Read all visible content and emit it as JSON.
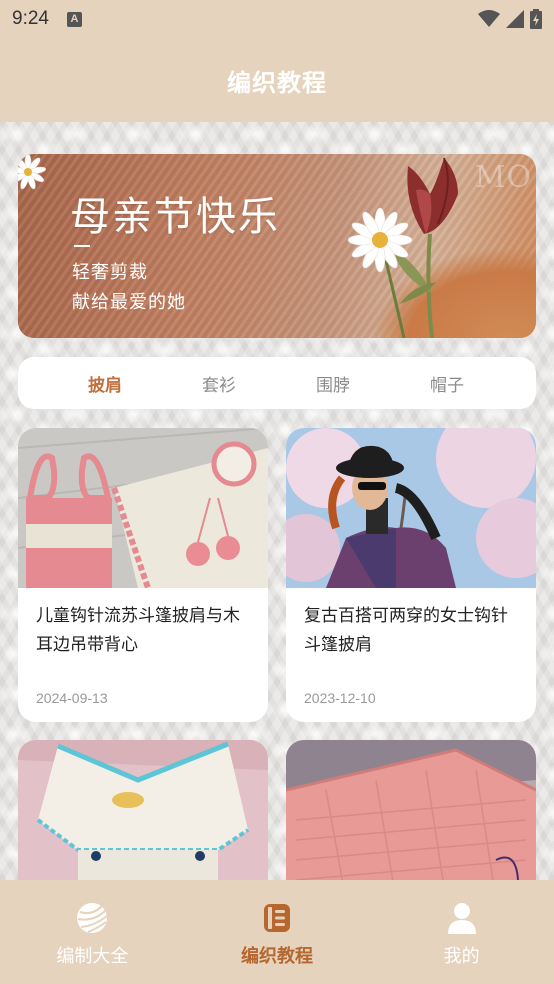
{
  "status_bar": {
    "time": "9:24",
    "a_icon": "A",
    "icons": [
      "wifi-icon",
      "signal-icon",
      "battery-charging-icon"
    ]
  },
  "header": {
    "title": "编织教程"
  },
  "banner": {
    "title": "母亲节快乐",
    "line1": "轻奢剪裁",
    "line2": "献给最爱的她",
    "watermark": "MO"
  },
  "tabs": [
    {
      "label": "披肩",
      "active": true
    },
    {
      "label": "套衫",
      "active": false
    },
    {
      "label": "围脖",
      "active": false
    },
    {
      "label": "帽子",
      "active": false
    }
  ],
  "cards": [
    {
      "title": "儿童钩针流苏斗篷披肩与木耳边吊带背心",
      "date": "2024-09-13"
    },
    {
      "title": "复古百搭可两穿的女士钩针斗篷披肩",
      "date": "2023-12-10"
    },
    {
      "title": "",
      "date": ""
    },
    {
      "title": "",
      "date": ""
    }
  ],
  "bottom_nav": [
    {
      "label": "编制大全",
      "icon": "yarn-ball-icon",
      "active": false
    },
    {
      "label": "编织教程",
      "icon": "list-book-icon",
      "active": true
    },
    {
      "label": "我的",
      "icon": "user-icon",
      "active": false
    }
  ],
  "colors": {
    "header_bg": "#e6d3bd",
    "accent": "#c0703e",
    "nav_active": "#b5672f"
  }
}
